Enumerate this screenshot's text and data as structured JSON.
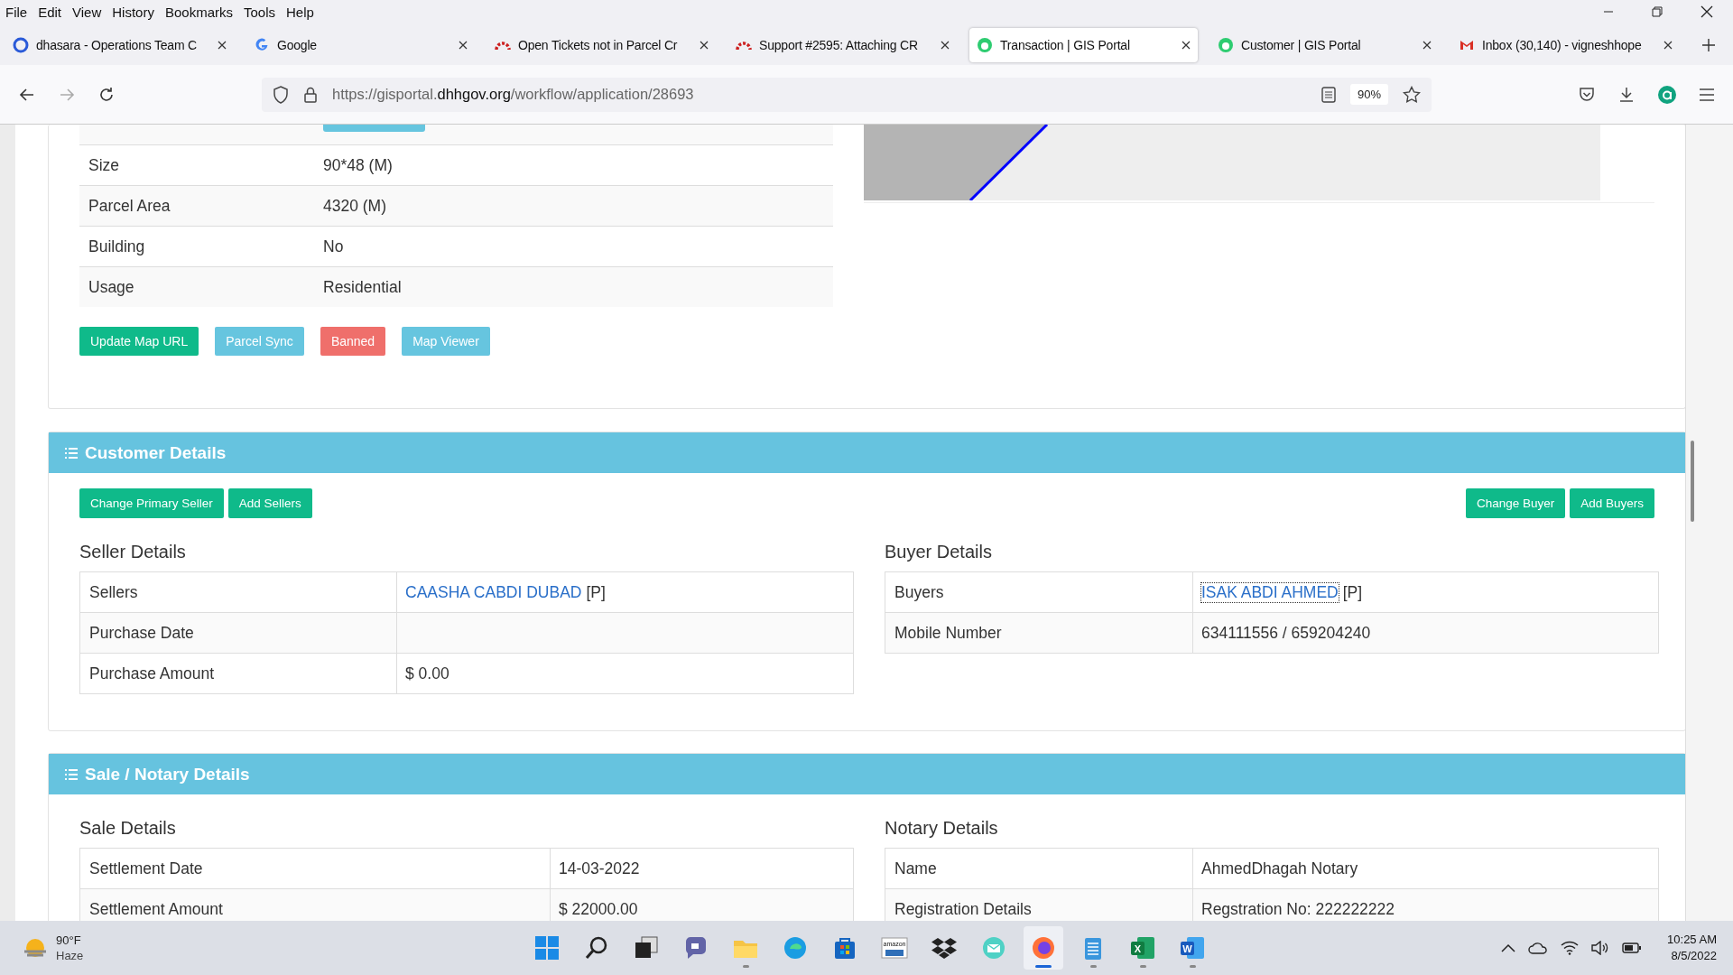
{
  "menu_bar": [
    "File",
    "Edit",
    "View",
    "History",
    "Bookmarks",
    "Tools",
    "Help"
  ],
  "tabs": [
    {
      "title": "dhasara - Operations Team C",
      "kind": "ring",
      "selected": false
    },
    {
      "title": "Google",
      "kind": "google",
      "selected": false
    },
    {
      "title": "Open Tickets not in Parcel Cr",
      "kind": "arc",
      "selected": false
    },
    {
      "title": "Support #2595: Attaching CR",
      "kind": "arc",
      "selected": false
    },
    {
      "title": "Transaction | GIS Portal",
      "kind": "gis",
      "selected": true
    },
    {
      "title": "Customer | GIS Portal",
      "kind": "gis",
      "selected": false
    },
    {
      "title": "Inbox (30,140) - vigneshhope",
      "kind": "mail",
      "selected": false
    }
  ],
  "address_bar": {
    "url_start": "https://gisportal.",
    "url_domain": "dhhgov.org",
    "url_end": "/workflow/application/28693",
    "zoom": "90%"
  },
  "parcel_table": [
    {
      "label": "Size",
      "value": "90*48 (M)"
    },
    {
      "label": "Parcel Area",
      "value": "4320 (M)"
    },
    {
      "label": "Building",
      "value": "No"
    },
    {
      "label": "Usage",
      "value": "Residential"
    }
  ],
  "parcel_buttons": [
    {
      "label": "Update Map URL",
      "kind": "success"
    },
    {
      "label": "Parcel Sync",
      "kind": "info"
    },
    {
      "label": "Banned",
      "kind": "danger"
    },
    {
      "label": "Map Viewer",
      "kind": "info"
    }
  ],
  "customer_section": {
    "title": "Customer Details",
    "seller_buttons": [
      "Change Primary Seller",
      "Add Sellers"
    ],
    "buyer_buttons": [
      "Change Buyer",
      "Add Buyers"
    ],
    "seller": {
      "heading": "Seller Details",
      "rows": [
        {
          "label": "Sellers",
          "link": "CAASHA CABDI DUBAD",
          "value": "[P]",
          "focused": false
        },
        {
          "label": "Purchase Date"
        },
        {
          "label": "Purchase Amount",
          "value": "$ 0.00"
        }
      ]
    },
    "buyer": {
      "heading": "Buyer Details",
      "rows": [
        {
          "label": "Buyers",
          "link": "ISAK ABDI AHMED",
          "value": "[P]",
          "focused": true
        },
        {
          "label": "Mobile Number",
          "value": "634111556 / 659204240"
        }
      ]
    }
  },
  "sale_section": {
    "title": "Sale / Notary Details",
    "sale": {
      "heading": "Sale Details",
      "rows": [
        {
          "label": "Settlement Date",
          "value": "14-03-2022"
        },
        {
          "label": "Settlement Amount",
          "value": "$ 22000.00"
        }
      ]
    },
    "notary": {
      "heading": "Notary Details",
      "rows": [
        {
          "label": "Name",
          "value": "AhmedDhagah Notary"
        },
        {
          "label": "Registration Details",
          "value": "Regstration No: 222222222"
        }
      ]
    }
  },
  "taskbar": {
    "weather": {
      "temperature": "90°F",
      "condition": "Haze"
    },
    "apps": [
      {
        "kind": "start",
        "running": false,
        "active": false
      },
      {
        "kind": "search",
        "running": false,
        "active": false
      },
      {
        "kind": "taskview",
        "running": false,
        "active": false
      },
      {
        "kind": "chat",
        "running": false,
        "active": false
      },
      {
        "kind": "folder",
        "running": true,
        "active": false
      },
      {
        "kind": "edge",
        "running": false,
        "active": false
      },
      {
        "kind": "store",
        "running": false,
        "active": false
      },
      {
        "kind": "amazon",
        "glyph": "amazon",
        "running": false,
        "active": false
      },
      {
        "kind": "dropbox",
        "running": false,
        "active": false
      },
      {
        "kind": "mail",
        "running": false,
        "active": false
      },
      {
        "kind": "firefox",
        "running": true,
        "active": true
      },
      {
        "kind": "notepad",
        "running": true,
        "active": false
      },
      {
        "kind": "excel",
        "glyph": "X",
        "running": true,
        "active": false
      },
      {
        "kind": "word",
        "glyph": "W",
        "running": true,
        "active": false
      }
    ],
    "clock": {
      "time": "10:25 AM",
      "date": "8/5/2022"
    }
  }
}
